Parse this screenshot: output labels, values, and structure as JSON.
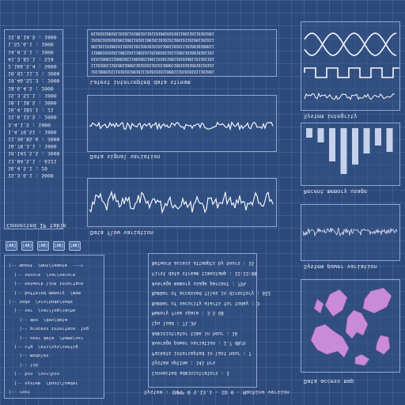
{
  "left_log": {
    "title": "Connected IP table",
    "lines": [
      "15.3.6.1 : 5000",
      "16.4.5.1 : 29",
      "13.84.5.1 : 6121",
      "10.142.5.5 : 3000",
      "16.78.3.1 : 1000",
      "11.36.85.6 : 3000",
      "1.4.70.51 : 1000",
      "3.4.1.5 : 1000",
      "31.6.13.5 : 2000",
      "16.4.182.1 : 21",
      "10.1.18.5 : 3000",
      "15.3.52.1 : 1000",
      "18.6.4.5 : 2000",
      "19.46.52.3 : 2000",
      "10.92.11.2 : 3000",
      "2.166.5.4 : 5000",
      "41.3.82.1 : 524",
      "14.0.3.1 : 1000",
      "1.52.6.1 : 1000",
      "15.8.14.5 : 1000"
    ]
  },
  "binary": {
    "title": "Latest intercepted data stream",
    "rows": [
      "1011000101110101010010111010101011000111010101011101001",
      "1110100111010011000110101011010110001100101010010110101",
      "0101100011100010111001001100110101100110101001101101101",
      "1100010101011001101110010110100101101110011010010101101",
      "0011011010010110101101100101010110011010111010010100011",
      "1010110101010011001101011001011010101100101101001101011",
      "0110101001011010110100101101101001010101100110110101001"
    ]
  },
  "wave_panel_1": {
    "title": "Data signal variation"
  },
  "wave_panel_2": {
    "title": "Data flow variation"
  },
  "status_history": {
    "title": "System integrity"
  },
  "energy_panel": {
    "title": "Recent memory usage"
  },
  "power_panel": {
    "title": "System power variation"
  },
  "map_panel": {
    "title": "Data access map"
  },
  "buttons": [
    "[AB]",
    "[AB]",
    "[AB]",
    "[AB]",
    "[AB]"
  ],
  "tree": {
    "lines": [
      "|-- root",
      "  |-- system  /boot/loader",
      "  |-- bin  /usr/bin",
      "    |-- lib",
      "    |-- modules",
      "  |-- cfg  /etc/sys/config",
      "    |-- user data  /home/usr",
      "    |-- process interface  log",
      "    |-- dev  /dev/data",
      "  |-- var  /var/log/cache",
      "|-- node  /srv/node/node",
      "  |-- buffered memory  /mem",
      "  |-- network link interface",
      "  |-- secure  /var/secure",
      "|-- mount  /mnt/remote  --->"
    ]
  },
  "stats": {
    "lines": [
      "Connected administrators : 3",
      "System uptime : 141 hrs",
      "Packets intercepted in last hour : 7",
      "Average power variation : 2.7 dB/h",
      "Administrator time in hour : 16",
      "Cpu load : 71.3%",
      "Memory free space : 3.5 GB",
      "Number of security alerts for today : 3",
      "Number of accessed files in directory : 652",
      "Average memory usage percent : 75%",
      "First data stream timestamp : 15:13:08",
      "Network access attempts by hours : 15"
    ],
    "footer": "System : SNMP 8 5.13.1 - ID 0 - Machine version"
  },
  "colors": {
    "accent": "#e8eef8",
    "map_fill": "#c98ad8",
    "bar": "#c6d2ec"
  }
}
